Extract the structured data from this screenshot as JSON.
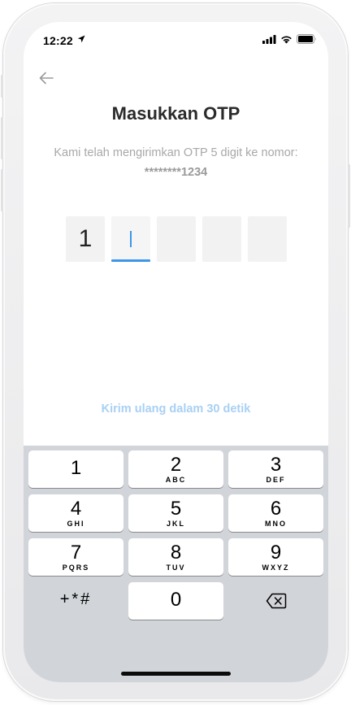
{
  "status_bar": {
    "time": "12:22",
    "icons": [
      "location-arrow-icon",
      "cellular-signal-icon",
      "wifi-icon",
      "battery-icon"
    ]
  },
  "header": {
    "back_icon": "arrow-left-icon"
  },
  "main": {
    "title": "Masukkan OTP",
    "subtitle": "Kami telah mengirimkan OTP 5 digit ke nomor:",
    "phone_masked": "********1234",
    "otp_digits": [
      "1",
      "",
      "",
      "",
      ""
    ],
    "active_index": 1,
    "resend_text": "Kirim ulang dalam 30 detik"
  },
  "keypad": {
    "keys": [
      {
        "num": "1",
        "letters": ""
      },
      {
        "num": "2",
        "letters": "ABC"
      },
      {
        "num": "3",
        "letters": "DEF"
      },
      {
        "num": "4",
        "letters": "GHI"
      },
      {
        "num": "5",
        "letters": "JKL"
      },
      {
        "num": "6",
        "letters": "MNO"
      },
      {
        "num": "7",
        "letters": "PQRS"
      },
      {
        "num": "8",
        "letters": "TUV"
      },
      {
        "num": "9",
        "letters": "WXYZ"
      }
    ],
    "symbols_label": "+*#",
    "zero": "0",
    "delete_icon": "backspace-icon"
  },
  "colors": {
    "accent": "#3d96e8",
    "resend": "#a8d0f4",
    "keyboard_bg": "#d1d4d9",
    "title": "#2b2b2b",
    "muted_text": "#a8a8ab"
  }
}
